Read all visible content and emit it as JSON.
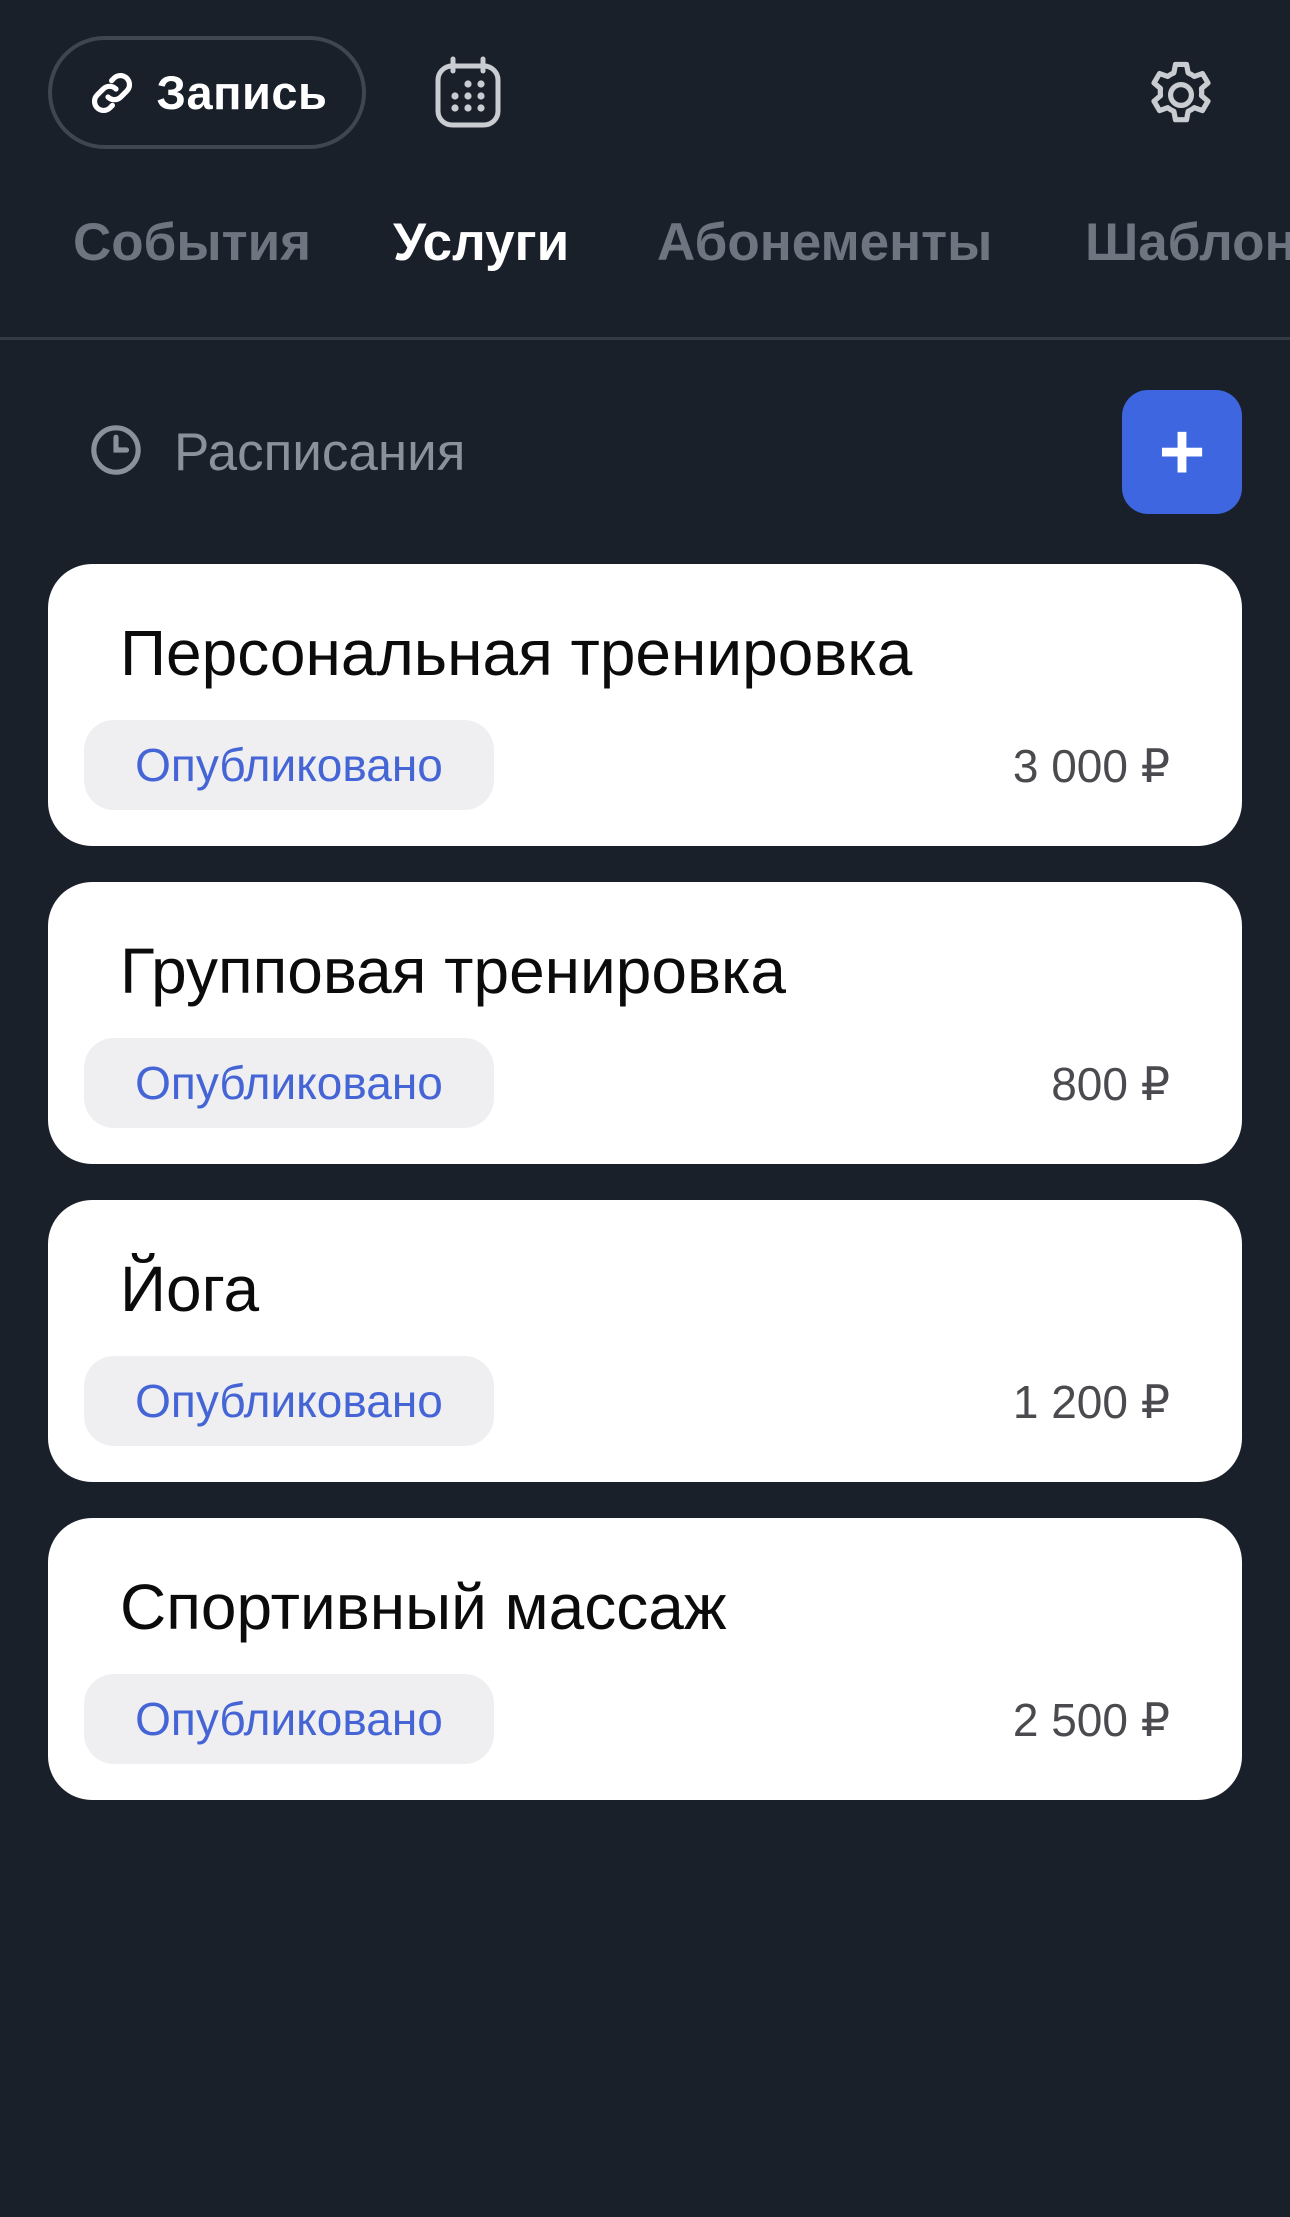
{
  "header": {
    "link_button_label": "Запись",
    "link_icon": "link-icon",
    "calendar_icon": "calendar-icon",
    "settings_icon": "gear-icon"
  },
  "tabs": [
    {
      "label": "События",
      "active": false
    },
    {
      "label": "Услуги",
      "active": true
    },
    {
      "label": "Абонементы",
      "active": false
    },
    {
      "label": "Шаблоны",
      "active": false
    }
  ],
  "section": {
    "icon": "clock-icon",
    "title": "Расписания",
    "add_label": "+"
  },
  "services": [
    {
      "title": "Персональная тренировка",
      "status": "Опубликовано",
      "price": "3 000 ₽"
    },
    {
      "title": "Групповая тренировка",
      "status": "Опубликовано",
      "price": "800 ₽"
    },
    {
      "title": "Йога",
      "status": "Опубликовано",
      "price": "1 200 ₽"
    },
    {
      "title": "Спортивный массаж",
      "status": "Опубликовано",
      "price": "2 500 ₽"
    }
  ],
  "colors": {
    "background": "#19202a",
    "accent": "#3e66e0",
    "status_text": "#4565d6",
    "inactive_tab": "#6d7580"
  }
}
